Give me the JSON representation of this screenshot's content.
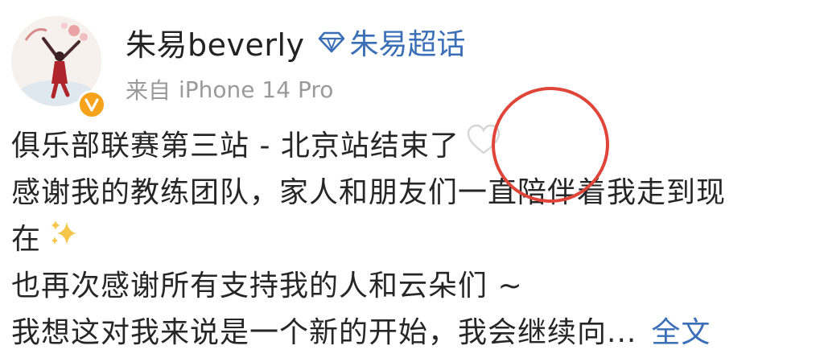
{
  "header": {
    "username": "朱易beverly",
    "diamond_icon": "diamond-icon",
    "super_topic": "朱易超话",
    "source_prefix": "来自",
    "device": "iPhone 14 Pro",
    "verified_icon": "verified-v-icon",
    "avatar_icon": "figure-skater-avatar"
  },
  "post": {
    "line1": "俱乐部联赛第三站 - 北京站结束了",
    "line1_emoji": "white-heart-icon",
    "line2": "感谢我的教练团队，家人和朋友们一直陪伴着我走到现",
    "line3": "在",
    "line3_emoji": "sparkles-icon",
    "line4": "也再次感谢所有支持我的人和云朵们 ~",
    "line5": "我想这对我来说是一个新的开始，我会继续向...",
    "full_text_label": "全文"
  },
  "annotation": {
    "shape": "red-circle-highlight",
    "color": "#e0453a"
  },
  "colors": {
    "link": "#3a6fb7",
    "meta": "#9a9a9a",
    "badge": "#f7a21b"
  }
}
